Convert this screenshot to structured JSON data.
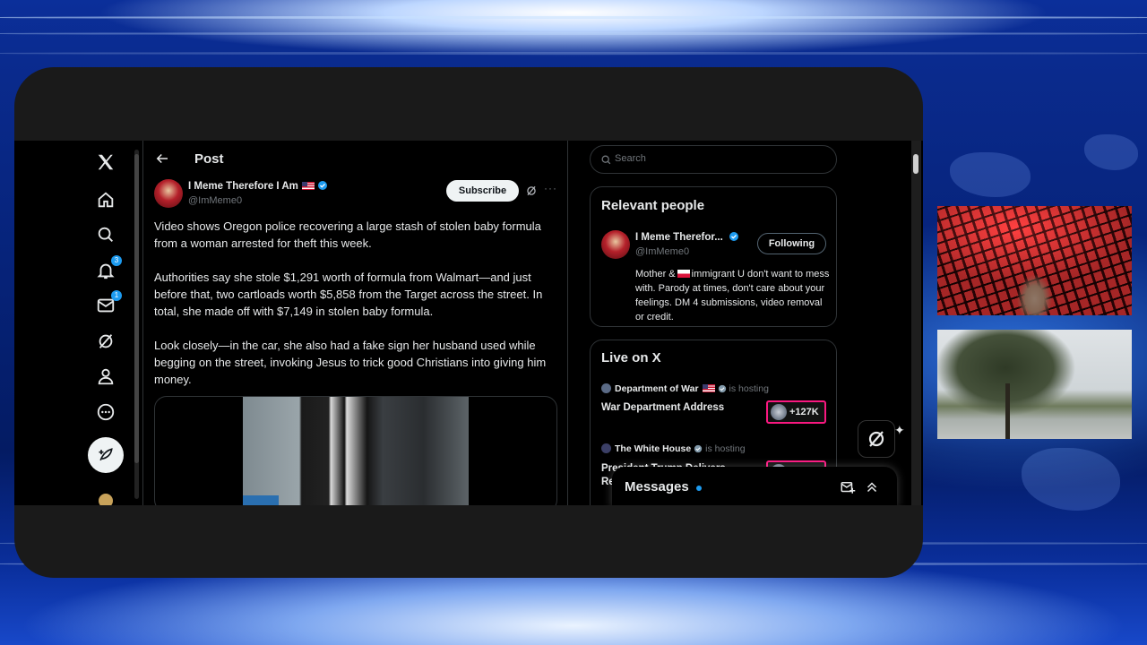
{
  "header": {
    "title": "Post"
  },
  "nav": {
    "notification_badge": "3",
    "messages_badge": "1"
  },
  "post": {
    "author": "I Meme Therefore I Am",
    "handle": "@ImMeme0",
    "subscribe_label": "Subscribe",
    "more_label": "···",
    "paragraphs": [
      "Video shows Oregon police recovering a large stash of stolen baby formula from a woman arrested for theft this week.",
      "Authorities say she stole $1,291 worth of formula from Walmart—and just before that, two cartloads worth $5,858 from the Target across the street. In total, she made off with $7,149 in stolen baby formula.",
      "Look closely—in the car, she also had a fake sign her husband used while begging on the street, invoking Jesus to trick good Christians into giving him money."
    ]
  },
  "search": {
    "placeholder": "Search"
  },
  "relevant_people": {
    "title": "Relevant people",
    "person_name": "I Meme Therefor...",
    "person_handle": "@ImMeme0",
    "follow_label": "Following",
    "bio_pre": "Mother &",
    "bio_post": "immigrant U don't want to mess with. Parody at times, don't care about your feelings. DM 4 submissions, video removal or credit."
  },
  "live": {
    "title": "Live on X",
    "items": [
      {
        "host": "Department of War",
        "hosting": "is hosting",
        "title": "War Department Address",
        "viewers": "+127K"
      },
      {
        "host": "The White House",
        "hosting": "is hosting",
        "title": "President Trump Delivers",
        "title2": "Re"
      }
    ]
  },
  "messages": {
    "title": "Messages"
  },
  "colors": {
    "accent": "#1d9bf0",
    "live_border": "#f91880",
    "background": "#000000"
  }
}
